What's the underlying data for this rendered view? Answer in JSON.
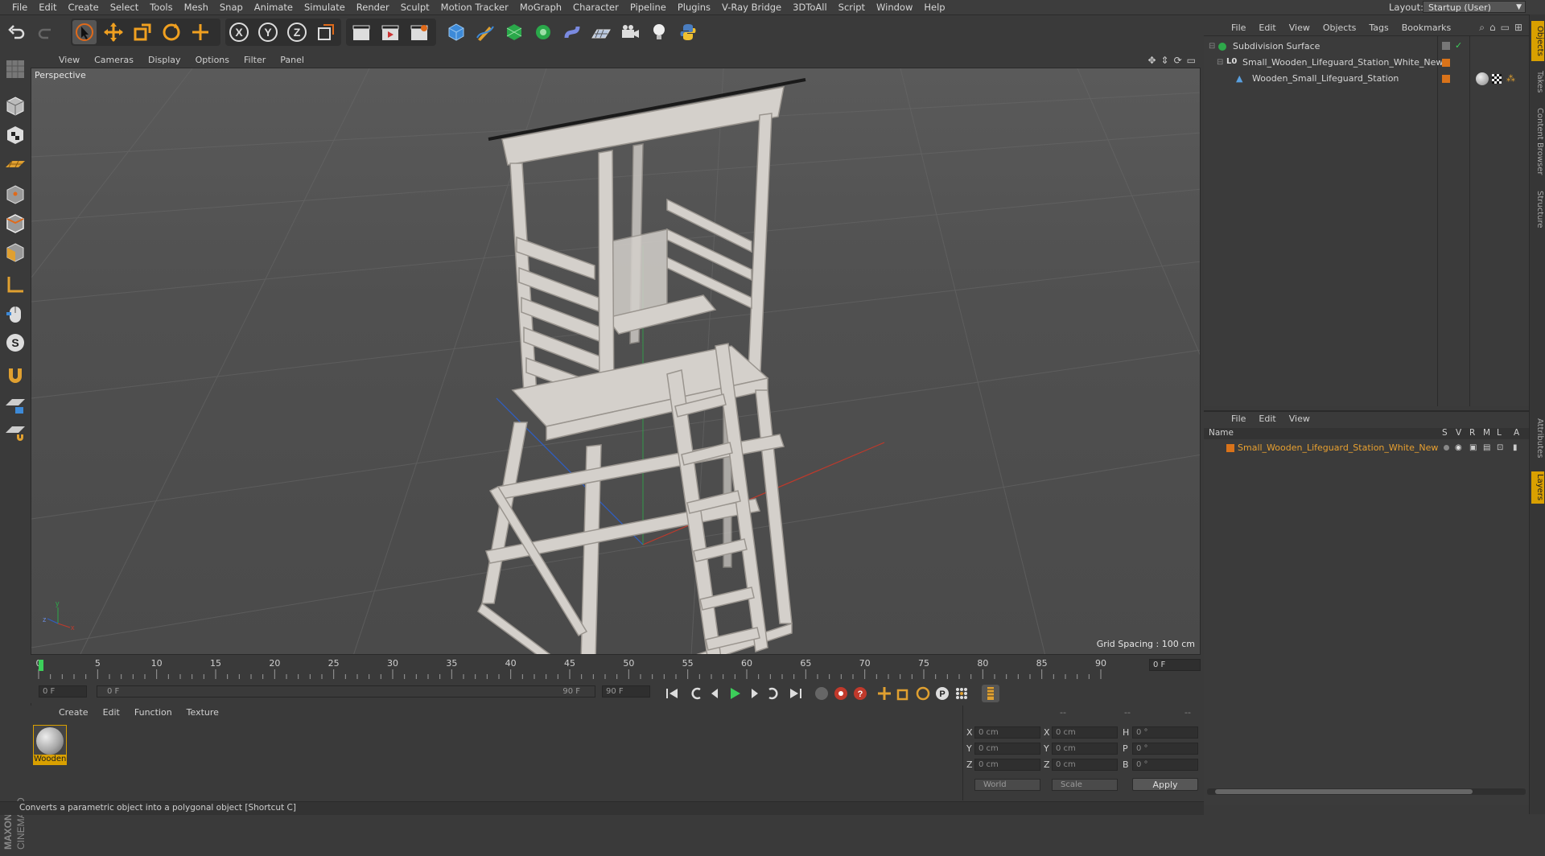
{
  "menubar": {
    "items": [
      "File",
      "Edit",
      "Create",
      "Select",
      "Tools",
      "Mesh",
      "Snap",
      "Animate",
      "Simulate",
      "Render",
      "Sculpt",
      "Motion Tracker",
      "MoGraph",
      "Character",
      "Pipeline",
      "Plugins",
      "V-Ray Bridge",
      "3DToAll",
      "Script",
      "Window",
      "Help"
    ],
    "layout_label": "Layout:",
    "layout_value": "Startup (User)"
  },
  "viewport": {
    "menu": [
      "View",
      "Cameras",
      "Display",
      "Options",
      "Filter",
      "Panel"
    ],
    "label": "Perspective",
    "grid_spacing": "Grid Spacing : 100 cm"
  },
  "timeline": {
    "ticks": [
      "0",
      "5",
      "10",
      "15",
      "20",
      "25",
      "30",
      "35",
      "40",
      "45",
      "50",
      "55",
      "60",
      "65",
      "70",
      "75",
      "80",
      "85",
      "90"
    ],
    "current_frame": "0 F"
  },
  "transport": {
    "start_field": "0 F",
    "range_start": "0 F",
    "range_end": "90 F",
    "end_field": "90 F"
  },
  "material_manager": {
    "menu": [
      "Create",
      "Edit",
      "Function",
      "Texture"
    ],
    "materials": [
      {
        "name": "Wooden"
      }
    ]
  },
  "coordinates": {
    "header": [
      "--",
      "--",
      "--"
    ],
    "rows": [
      {
        "l1": "X",
        "v1": "0 cm",
        "l2": "X",
        "v2": "0 cm",
        "l3": "H",
        "v3": "0 °"
      },
      {
        "l1": "Y",
        "v1": "0 cm",
        "l2": "Y",
        "v2": "0 cm",
        "l3": "P",
        "v3": "0 °"
      },
      {
        "l1": "Z",
        "v1": "0 cm",
        "l2": "Z",
        "v2": "0 cm",
        "l3": "B",
        "v3": "0 °"
      }
    ],
    "space_dropdown": "World",
    "mode_dropdown": "Scale",
    "apply_label": "Apply"
  },
  "status_bar": {
    "text": "Converts a parametric object into a polygonal object [Shortcut C]"
  },
  "object_manager": {
    "menu": [
      "File",
      "Edit",
      "View",
      "Objects",
      "Tags",
      "Bookmarks"
    ],
    "objects": [
      {
        "name": "Subdivision Surface"
      },
      {
        "name": "Small_Wooden_Lifeguard_Station_White_New"
      },
      {
        "name": "Wooden_Small_Lifeguard_Station"
      }
    ]
  },
  "layer_manager": {
    "menu": [
      "File",
      "Edit",
      "View"
    ],
    "columns": [
      "Name",
      "S",
      "V",
      "R",
      "M",
      "L",
      "A"
    ],
    "layers": [
      {
        "name": "Small_Wooden_Lifeguard_Station_White_New",
        "color": "#e08a1e"
      }
    ]
  },
  "side_tabs": [
    "Objects",
    "Takes",
    "Content Browser",
    "Structure",
    "Attributes",
    "Layers"
  ],
  "colors": {
    "accent": "#d9a000",
    "layer_orange": "#e08a1e"
  }
}
